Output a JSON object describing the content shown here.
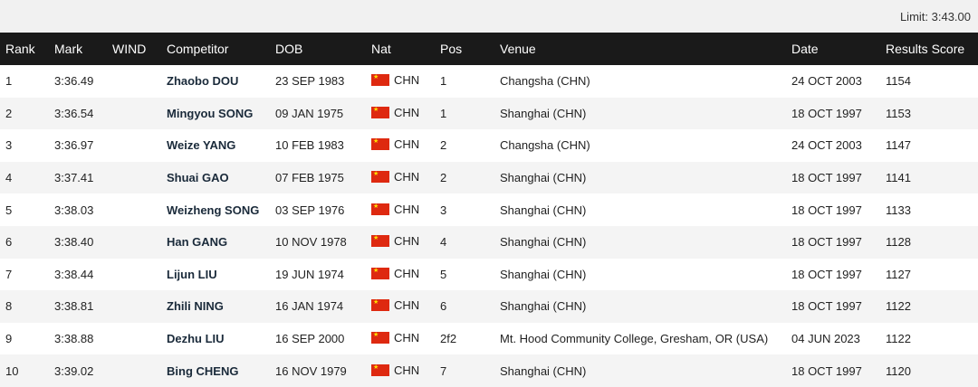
{
  "limit": "Limit: 3:43.00",
  "headers": {
    "rank": "Rank",
    "mark": "Mark",
    "wind": "WIND",
    "competitor": "Competitor",
    "dob": "DOB",
    "nat": "Nat",
    "pos": "Pos",
    "venue": "Venue",
    "date": "Date",
    "score": "Results Score"
  },
  "colors": {
    "header_bg": "#1a1a1a",
    "stripe": "#f4f4f4",
    "flag_red": "#de2910",
    "flag_star": "#ffde00"
  },
  "rows": [
    {
      "rank": "1",
      "mark": "3:36.49",
      "wind": "",
      "competitor": "Zhaobo DOU",
      "dob": "23 SEP 1983",
      "flag": "china-flag-icon",
      "nat": "CHN",
      "pos": "1",
      "venue": "Changsha (CHN)",
      "date": "24 OCT 2003",
      "score": "1154"
    },
    {
      "rank": "2",
      "mark": "3:36.54",
      "wind": "",
      "competitor": "Mingyou SONG",
      "dob": "09 JAN 1975",
      "flag": "china-flag-icon",
      "nat": "CHN",
      "pos": "1",
      "venue": "Shanghai (CHN)",
      "date": "18 OCT 1997",
      "score": "1153"
    },
    {
      "rank": "3",
      "mark": "3:36.97",
      "wind": "",
      "competitor": "Weize YANG",
      "dob": "10 FEB 1983",
      "flag": "china-flag-icon",
      "nat": "CHN",
      "pos": "2",
      "venue": "Changsha (CHN)",
      "date": "24 OCT 2003",
      "score": "1147"
    },
    {
      "rank": "4",
      "mark": "3:37.41",
      "wind": "",
      "competitor": "Shuai GAO",
      "dob": "07 FEB 1975",
      "flag": "china-flag-icon",
      "nat": "CHN",
      "pos": "2",
      "venue": "Shanghai (CHN)",
      "date": "18 OCT 1997",
      "score": "1141"
    },
    {
      "rank": "5",
      "mark": "3:38.03",
      "wind": "",
      "competitor": "Weizheng SONG",
      "dob": "03 SEP 1976",
      "flag": "china-flag-icon",
      "nat": "CHN",
      "pos": "3",
      "venue": "Shanghai (CHN)",
      "date": "18 OCT 1997",
      "score": "1133"
    },
    {
      "rank": "6",
      "mark": "3:38.40",
      "wind": "",
      "competitor": "Han GANG",
      "dob": "10 NOV 1978",
      "flag": "china-flag-icon",
      "nat": "CHN",
      "pos": "4",
      "venue": "Shanghai (CHN)",
      "date": "18 OCT 1997",
      "score": "1128"
    },
    {
      "rank": "7",
      "mark": "3:38.44",
      "wind": "",
      "competitor": "Lijun LIU",
      "dob": "19 JUN 1974",
      "flag": "china-flag-icon",
      "nat": "CHN",
      "pos": "5",
      "venue": "Shanghai (CHN)",
      "date": "18 OCT 1997",
      "score": "1127"
    },
    {
      "rank": "8",
      "mark": "3:38.81",
      "wind": "",
      "competitor": "Zhili NING",
      "dob": "16 JAN 1974",
      "flag": "china-flag-icon",
      "nat": "CHN",
      "pos": "6",
      "venue": "Shanghai (CHN)",
      "date": "18 OCT 1997",
      "score": "1122"
    },
    {
      "rank": "9",
      "mark": "3:38.88",
      "wind": "",
      "competitor": "Dezhu LIU",
      "dob": "16 SEP 2000",
      "flag": "china-flag-icon",
      "nat": "CHN",
      "pos": "2f2",
      "venue": "Mt. Hood Community College, Gresham, OR (USA)",
      "date": "04 JUN 2023",
      "score": "1122"
    },
    {
      "rank": "10",
      "mark": "3:39.02",
      "wind": "",
      "competitor": "Bing CHENG",
      "dob": "16 NOV 1979",
      "flag": "china-flag-icon",
      "nat": "CHN",
      "pos": "7",
      "venue": "Shanghai (CHN)",
      "date": "18 OCT 1997",
      "score": "1120"
    }
  ]
}
